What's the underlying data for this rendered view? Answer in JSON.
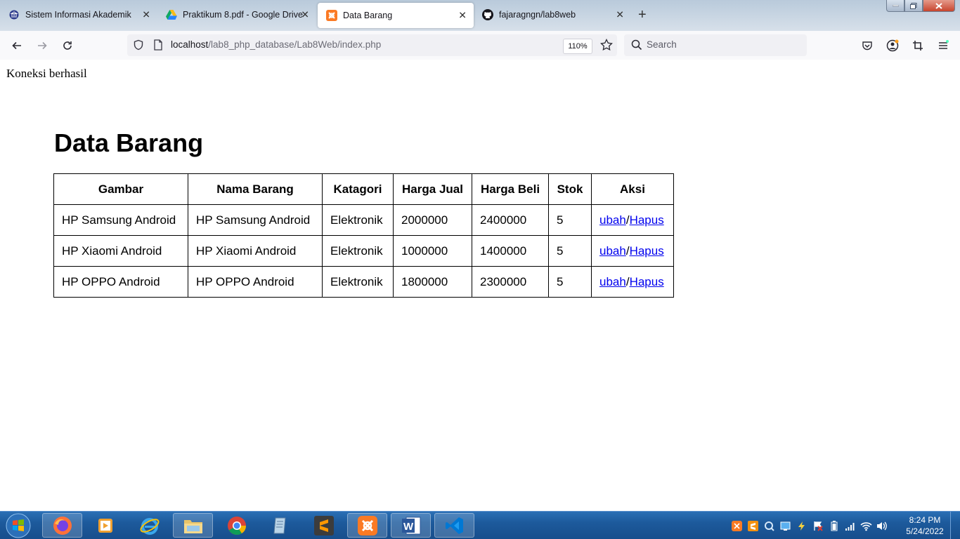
{
  "browser": {
    "tabs": [
      {
        "label": "Sistem Informasi Akademik",
        "icon": "university-icon",
        "active": false
      },
      {
        "label": "Praktikum 8.pdf - Google Drive",
        "icon": "google-drive-icon",
        "active": false
      },
      {
        "label": "Data Barang",
        "icon": "xampp-icon",
        "active": true
      },
      {
        "label": "fajaragngn/lab8web",
        "icon": "github-icon",
        "active": false
      }
    ],
    "new_tab_label": "+",
    "url_host": "localhost",
    "url_path": "/lab8_php_database/Lab8Web/index.php",
    "zoom": "110%",
    "search_placeholder": "Search"
  },
  "page": {
    "connection_message": "Koneksi berhasil",
    "title": "Data Barang",
    "table": {
      "headers": [
        "Gambar",
        "Nama Barang",
        "Katagori",
        "Harga Jual",
        "Harga Beli",
        "Stok",
        "Aksi"
      ],
      "rows": [
        {
          "gambar": "HP Samsung Android",
          "nama": "HP Samsung Android",
          "kategori": "Elektronik",
          "harga_jual": "2000000",
          "harga_beli": "2400000",
          "stok": "5"
        },
        {
          "gambar": "HP Xiaomi Android",
          "nama": "HP Xiaomi Android",
          "kategori": "Elektronik",
          "harga_jual": "1000000",
          "harga_beli": "1400000",
          "stok": "5"
        },
        {
          "gambar": "HP OPPO Android",
          "nama": "HP OPPO Android",
          "kategori": "Elektronik",
          "harga_jual": "1800000",
          "harga_beli": "2300000",
          "stok": "5"
        }
      ],
      "action_edit": "ubah",
      "action_separator": "/",
      "action_delete": "Hapus"
    }
  },
  "taskbar": {
    "apps": [
      "firefox-icon",
      "media-player-icon",
      "internet-explorer-icon",
      "file-explorer-icon",
      "chrome-icon",
      "notepad-icon",
      "sublime-text-icon",
      "xampp-icon",
      "word-icon",
      "vscode-icon"
    ],
    "time": "8:24 PM",
    "date": "5/24/2022"
  },
  "colors": {
    "link": "#0000ee",
    "taskbar": "#1d5a9c",
    "tabbar": "#c9d6e3"
  }
}
